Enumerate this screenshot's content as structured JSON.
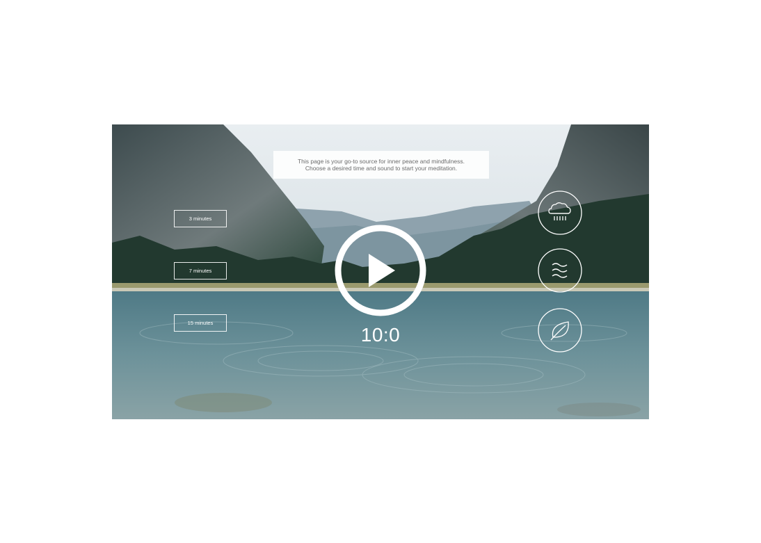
{
  "intro": {
    "line1": "This page is your go-to source for inner peace and mindfulness.",
    "line2": "Choose a desired time and sound to start your meditation."
  },
  "durations": [
    {
      "label": "3 minutes"
    },
    {
      "label": "7 minutes"
    },
    {
      "label": "15 minutes"
    }
  ],
  "timer": {
    "display": "10:0"
  },
  "sounds": [
    {
      "icon": "rain-cloud-icon"
    },
    {
      "icon": "wind-waves-icon"
    },
    {
      "icon": "leaf-icon"
    }
  ],
  "colors": {
    "accent": "#ffffff",
    "sky": "#dfe6ea",
    "water": "#5f8791"
  }
}
